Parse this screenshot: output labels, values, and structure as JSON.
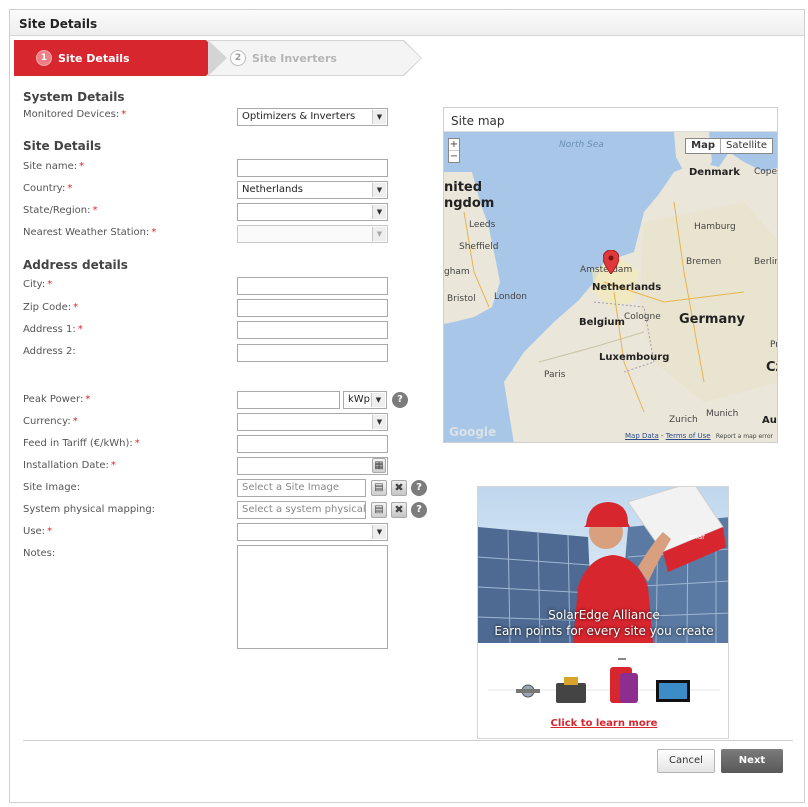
{
  "panel": {
    "title": "Site Details"
  },
  "wizard": {
    "steps": [
      {
        "num": "1",
        "label": "Site Details"
      },
      {
        "num": "2",
        "label": "Site Inverters"
      }
    ]
  },
  "sections": {
    "system": "System Details",
    "site": "Site Details",
    "address": "Address details"
  },
  "labels": {
    "monitored_devices": "Monitored Devices:",
    "site_name": "Site name:",
    "country": "Country:",
    "state_region": "State/Region:",
    "nearest_weather": "Nearest Weather Station:",
    "city": "City:",
    "zip": "Zip Code:",
    "address1": "Address 1:",
    "address2": "Address 2:",
    "peak_power": "Peak Power:",
    "currency": "Currency:",
    "feed_in_tariff": "Feed in Tariff (€/kWh):",
    "installation_date": "Installation Date:",
    "site_image": "Site Image:",
    "system_mapping": "System physical mapping:",
    "use": "Use:",
    "notes": "Notes:"
  },
  "required_mark": "*",
  "values": {
    "monitored_devices": "Optimizers & Inverters",
    "country": "Netherlands",
    "peak_power_unit": "kWp"
  },
  "placeholders": {
    "site_image": "Select a Site Image",
    "system_mapping": "Select a system physical m"
  },
  "map": {
    "title": "Site map",
    "toggle_map": "Map",
    "toggle_satellite": "Satellite",
    "zoom_in": "+",
    "zoom_out": "−",
    "labels": {
      "north_sea": "North Sea",
      "denmark": "Denmark",
      "copenhagen": "Cope",
      "united": "nited",
      "kingdom": "ngdom",
      "leeds": "Leeds",
      "sheffield": "Sheffield",
      "birmingham": "gham",
      "bristol": "Bristol",
      "london": "London",
      "amsterdam": "Amsterdam",
      "netherlands": "Netherlands",
      "hamburg": "Hamburg",
      "bremen": "Bremen",
      "berlin": "Berlin",
      "belgium": "Belgium",
      "cologne": "Cologne",
      "germany": "Germany",
      "luxembourg": "Luxembourg",
      "paris": "Paris",
      "zurich": "Zurich",
      "munich": "Munich",
      "austria": "Aus",
      "czech": "Cz",
      "prague": "Pr"
    },
    "watermark": "Google",
    "footer_data": "Map Data",
    "footer_sep": " - ",
    "footer_terms": "Terms of Use",
    "footer_report": "Report a map error"
  },
  "promo": {
    "line1": "SolarEdge Alliance",
    "line2": "Earn points for every site you create",
    "link": "Click to learn more",
    "box_brand": "solar"
  },
  "buttons": {
    "cancel": "Cancel",
    "next": "Next",
    "help": "?",
    "remove": "✖",
    "browse": "▤",
    "calendar": "▦"
  },
  "icons": {
    "dropdown": "chevron-down-icon",
    "help": "help-icon",
    "remove": "remove-icon",
    "browse": "browse-icon",
    "calendar": "calendar-icon",
    "map_pin": "map-pin-icon"
  },
  "colors": {
    "accent": "#d8262f",
    "next_button": "#5f5f5f"
  }
}
